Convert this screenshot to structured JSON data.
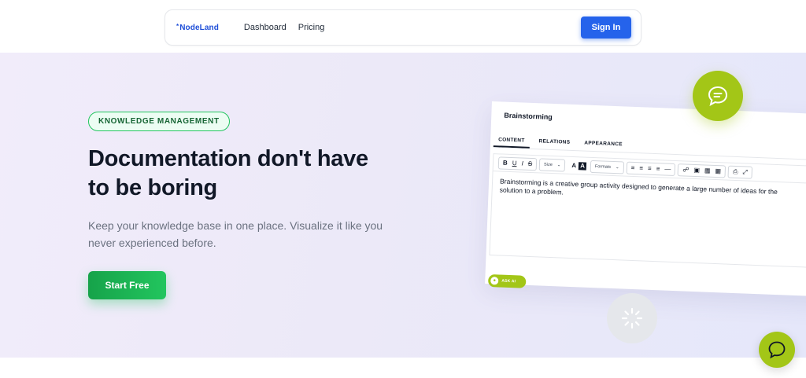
{
  "nav": {
    "logo": "NodeLand",
    "logo_mark": "*",
    "links": [
      "Dashboard",
      "Pricing"
    ],
    "signin_label": "Sign In"
  },
  "hero": {
    "badge": "KNOWLEDGE MANAGEMENT",
    "headline_line1": "Documentation don't have",
    "headline_line2": "to be boring",
    "subtext_line1": "Keep your knowledge base in one place. Visualize it like you",
    "subtext_line2": "never experienced before.",
    "cta_label": "Start Free"
  },
  "editor": {
    "title": "Brainstorming",
    "tabs": [
      "CONTENT",
      "RELATIONS",
      "APPEARANCE"
    ],
    "toolbar": {
      "bold": "B",
      "underline": "U",
      "italic": "I",
      "strike": "S",
      "size": "Size",
      "font_color": "A",
      "bg_color": "A",
      "formats": "Formats"
    },
    "body_line1": "Brainstorming is a creative group activity designed to generate a large number of ideas for the",
    "body_line2": "solution to a problem.",
    "ask_ai": "ASK AI"
  },
  "colors": {
    "brand_blue": "#2563eb",
    "brand_green": "#22c55e",
    "accent_lime": "#a3c617"
  },
  "icons": {
    "hero_chat": "chat-bubble-icon",
    "spinner": "loading-spinner-icon",
    "fab": "chat-icon"
  }
}
